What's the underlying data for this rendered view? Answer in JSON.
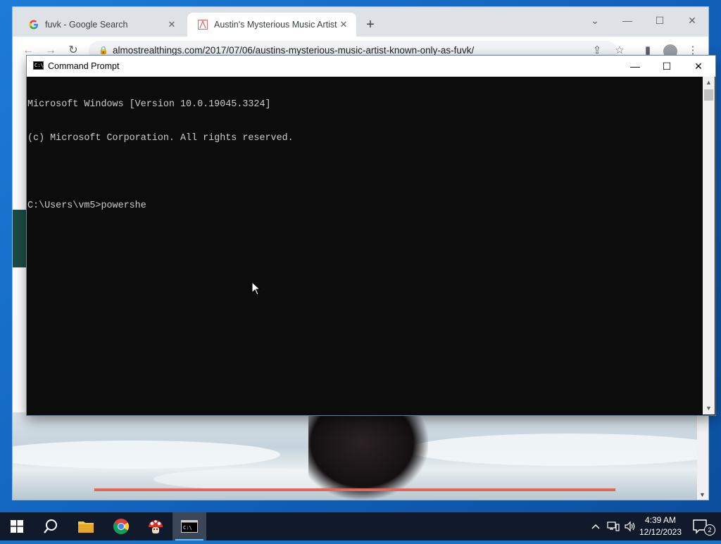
{
  "browser": {
    "tabs": [
      {
        "title": "fuvk - Google Search",
        "favicon": "google-g-icon",
        "active": false
      },
      {
        "title": "Austin's Mysterious Music Artist Known Only as fuvk",
        "favicon": "site-icon",
        "active": true
      }
    ],
    "new_tab_label": "+",
    "url": "almostrealthings.com/2017/07/06/austins-mysterious-music-artist-known-only-as-fuvk/"
  },
  "cmd": {
    "title": "Command Prompt",
    "lines": [
      "Microsoft Windows [Version 10.0.19045.3324]",
      "(c) Microsoft Corporation. All rights reserved.",
      "",
      "C:\\Users\\vm5>powershe"
    ],
    "bg_color": "#0c0c0c",
    "text_color": "#cccccc"
  },
  "taskbar": {
    "apps": [
      "start-icon",
      "search-icon",
      "file-explorer-icon",
      "chrome-icon",
      "mushroom-app-icon",
      "command-prompt-icon"
    ],
    "time": "4:39 AM",
    "date": "12/12/2023",
    "notification_count": "2"
  },
  "colors": {
    "accent": "#1a73c9",
    "page_accent_red": "#e0675a",
    "page_band_green": "#1d4b45"
  }
}
